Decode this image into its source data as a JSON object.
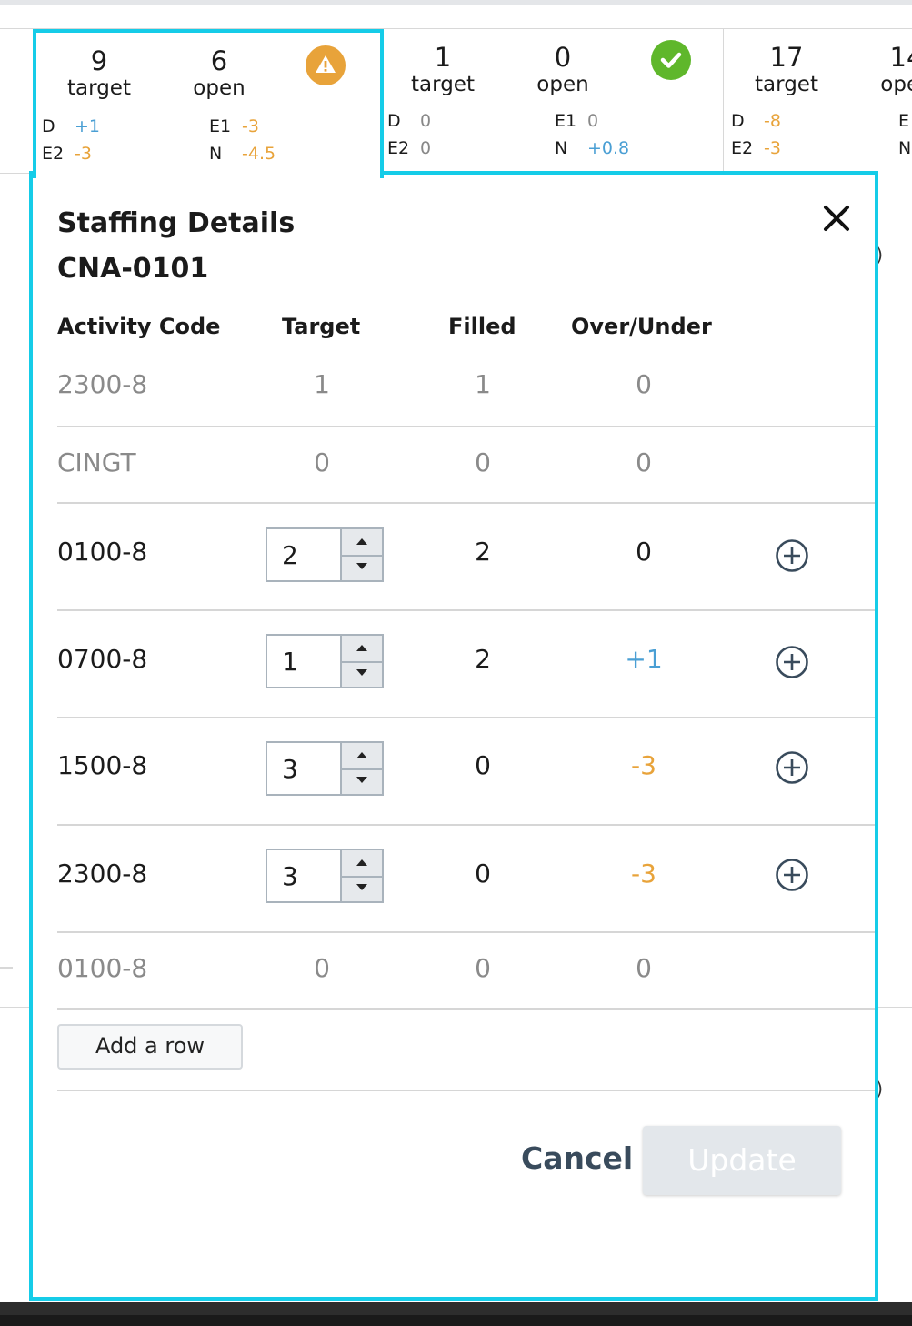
{
  "tiles": [
    {
      "target": "9",
      "target_label": "target",
      "open": "6",
      "open_label": "open",
      "status_icon": "warning-icon",
      "details": [
        {
          "key": "D",
          "value": "+1",
          "color": "#4a9fd4"
        },
        {
          "key": "E1",
          "value": "-3",
          "color": "#e8a33a"
        },
        {
          "key": "E2",
          "value": "-3",
          "color": "#e8a33a"
        },
        {
          "key": "N",
          "value": "-4.5",
          "color": "#e8a33a"
        }
      ]
    },
    {
      "target": "1",
      "target_label": "target",
      "open": "0",
      "open_label": "open",
      "status_icon": "check-icon",
      "details": [
        {
          "key": "D",
          "value": "0",
          "color": "#888888"
        },
        {
          "key": "E1",
          "value": "0",
          "color": "#888888"
        },
        {
          "key": "E2",
          "value": "0",
          "color": "#888888"
        },
        {
          "key": "N",
          "value": "+0.8",
          "color": "#4a9fd4"
        }
      ]
    },
    {
      "target": "17",
      "target_label": "target",
      "open": "14",
      "open_label": "open",
      "details": [
        {
          "key": "D",
          "value": "-8",
          "color": "#e8a33a"
        },
        {
          "key": "E",
          "value": ""
        },
        {
          "key": "E2",
          "value": "-3",
          "color": "#e8a33a"
        },
        {
          "key": "N",
          "value": ""
        }
      ]
    }
  ],
  "panel": {
    "title": "Staffing Details",
    "subtitle": "CNA-0101",
    "columns": [
      "Activity Code",
      "Target",
      "Filled",
      "Over/Under"
    ],
    "rows": [
      {
        "code": "2300-8",
        "target": "1",
        "filled": "1",
        "over_under": "0",
        "editable": false
      },
      {
        "code": "CINGT",
        "target": "0",
        "filled": "0",
        "over_under": "0",
        "editable": false
      },
      {
        "code": "0100-8",
        "target": "2",
        "filled": "2",
        "over_under": "0",
        "editable": true
      },
      {
        "code": "0700-8",
        "target": "1",
        "filled": "2",
        "over_under": "+1",
        "editable": true
      },
      {
        "code": "1500-8",
        "target": "3",
        "filled": "0",
        "over_under": "-3",
        "editable": true
      },
      {
        "code": "2300-8",
        "target": "3",
        "filled": "0",
        "over_under": "-3",
        "editable": true
      },
      {
        "code": "0100-8",
        "target": "0",
        "filled": "0",
        "over_under": "0",
        "editable": false
      }
    ],
    "add_row_label": "Add a row",
    "cancel_label": "Cancel",
    "update_label": "Update"
  },
  "colors": {
    "accent": "#15cce8",
    "positive": "#4a9fd4",
    "negative": "#e8a33a",
    "warning": "#e8a33a",
    "success": "#5fb72b"
  }
}
